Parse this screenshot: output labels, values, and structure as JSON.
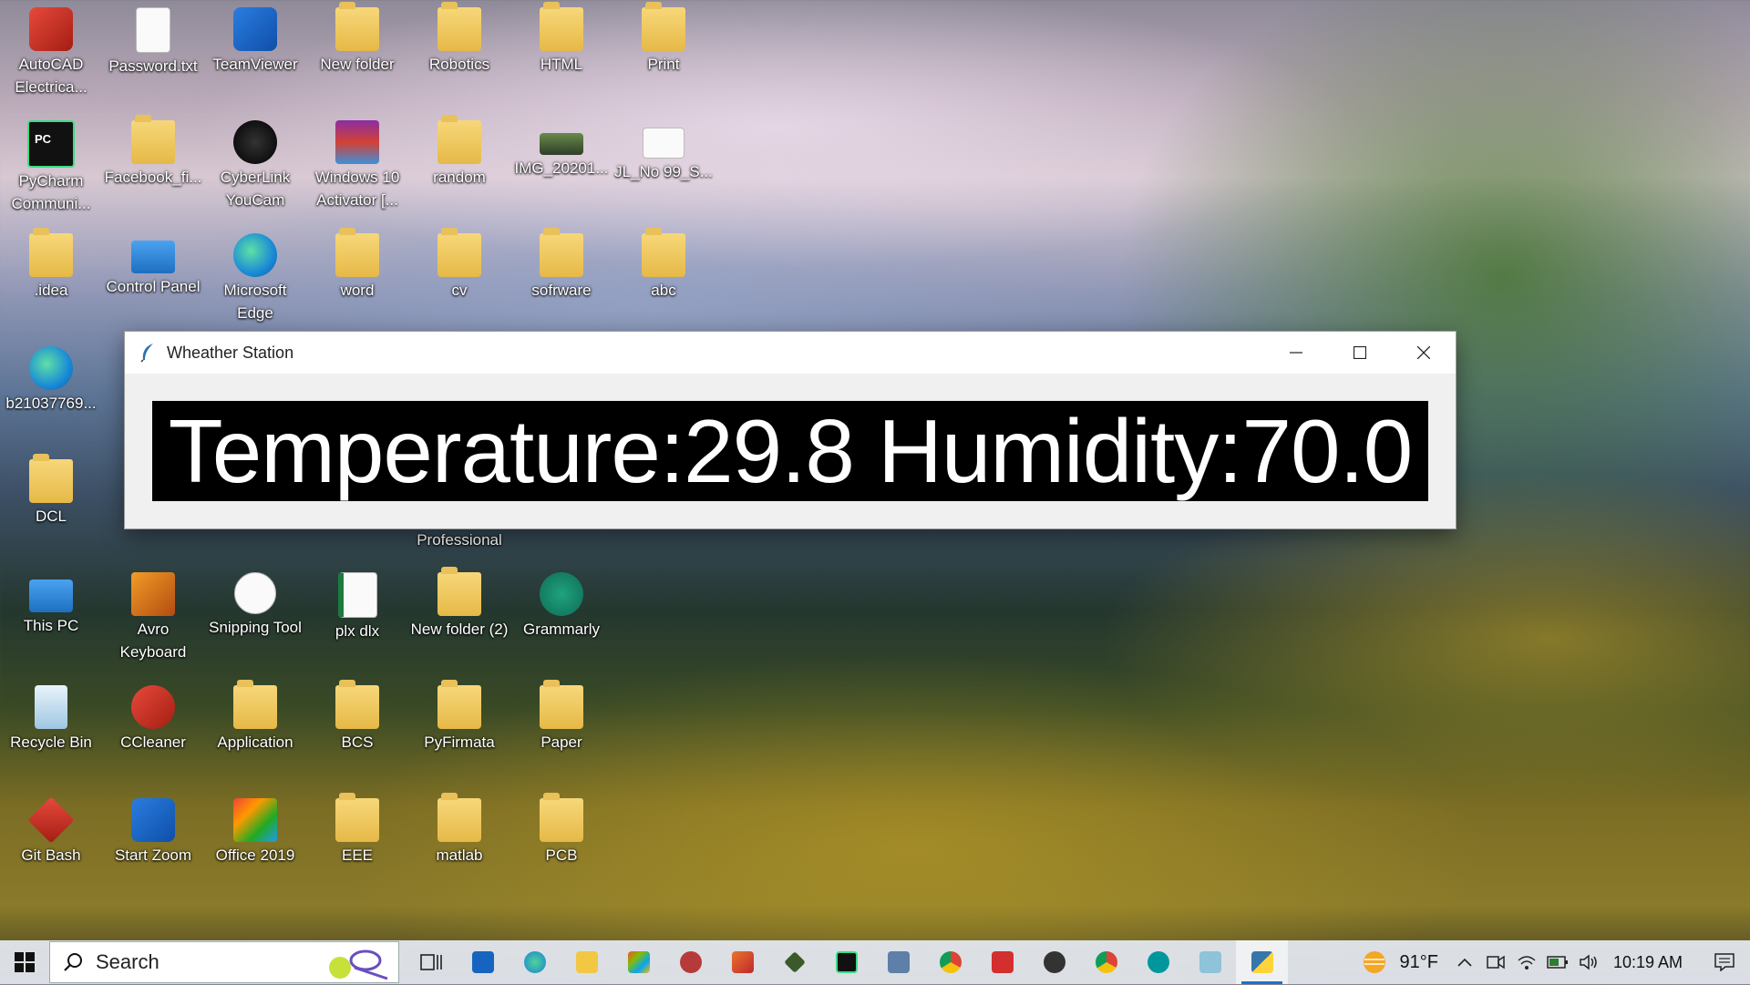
{
  "desktop": {
    "icons": [
      {
        "label": "AutoCAD Electrica...",
        "icon": "autocad-icon"
      },
      {
        "label": "Password.txt",
        "icon": "text-file-icon"
      },
      {
        "label": "TeamViewer",
        "icon": "teamviewer-icon"
      },
      {
        "label": "New folder",
        "icon": "folder-icon"
      },
      {
        "label": "Robotics",
        "icon": "folder-icon"
      },
      {
        "label": "HTML",
        "icon": "folder-icon"
      },
      {
        "label": "Print",
        "icon": "folder-icon"
      },
      {
        "label": "PyCharm Communi...",
        "icon": "pycharm-icon"
      },
      {
        "label": "Facebook_fi...",
        "icon": "folder-icon"
      },
      {
        "label": "CyberLink YouCam",
        "icon": "youcam-icon"
      },
      {
        "label": "Windows 10 Activator [...",
        "icon": "winrar-icon"
      },
      {
        "label": "random",
        "icon": "folder-icon"
      },
      {
        "label": "IMG_20201...",
        "icon": "image-file-icon"
      },
      {
        "label": "JL_No 99_S...",
        "icon": "image-file-icon"
      },
      {
        "label": ".idea",
        "icon": "folder-icon"
      },
      {
        "label": "Control Panel",
        "icon": "control-panel-icon"
      },
      {
        "label": "Microsoft Edge",
        "icon": "edge-icon"
      },
      {
        "label": "word",
        "icon": "folder-icon"
      },
      {
        "label": "cv",
        "icon": "folder-icon"
      },
      {
        "label": "sofrware",
        "icon": "folder-icon"
      },
      {
        "label": "abc",
        "icon": "folder-icon"
      },
      {
        "label": "b21037769...",
        "icon": "edge-icon"
      },
      {
        "label": "DCL",
        "icon": "user-folder-icon"
      },
      {
        "label": "Professional",
        "icon": "folder-icon"
      },
      {
        "label": "This PC",
        "icon": "this-pc-icon"
      },
      {
        "label": "Avro Keyboard",
        "icon": "avro-icon"
      },
      {
        "label": "Snipping Tool",
        "icon": "snipping-tool-icon"
      },
      {
        "label": "plx dlx",
        "icon": "excel-file-icon"
      },
      {
        "label": "New folder (2)",
        "icon": "folder-icon"
      },
      {
        "label": "Grammarly",
        "icon": "grammarly-icon"
      },
      {
        "label": "Recycle Bin",
        "icon": "recycle-bin-icon"
      },
      {
        "label": "CCleaner",
        "icon": "ccleaner-icon"
      },
      {
        "label": "Application",
        "icon": "folder-icon"
      },
      {
        "label": "BCS",
        "icon": "folder-icon"
      },
      {
        "label": "PyFirmata",
        "icon": "folder-icon"
      },
      {
        "label": "Paper",
        "icon": "folder-icon"
      },
      {
        "label": "Git Bash",
        "icon": "git-bash-icon"
      },
      {
        "label": "Start Zoom",
        "icon": "zoom-icon"
      },
      {
        "label": "Office 2019",
        "icon": "office-icon"
      },
      {
        "label": "EEE",
        "icon": "folder-icon"
      },
      {
        "label": "matlab",
        "icon": "folder-icon"
      },
      {
        "label": "PCB",
        "icon": "folder-icon"
      }
    ]
  },
  "window": {
    "title": "Wheather Station",
    "readout": "Temperature:29.8 Humidity:70.0"
  },
  "taskbar": {
    "search_placeholder": "Search",
    "apps": [
      "task-view-icon",
      "mail-icon",
      "edge-icon",
      "file-explorer-icon",
      "store-icon",
      "app-icon",
      "matlab-icon",
      "app-icon",
      "pycharm-icon",
      "app-icon",
      "chrome-icon",
      "app-icon",
      "settings-icon",
      "chrome-icon",
      "arduino-icon",
      "app-icon",
      "python-icon"
    ],
    "weather_temp": "91°F",
    "time": "10:19 AM"
  },
  "colors": {
    "readout_bg": "#000000",
    "readout_fg": "#ffffff",
    "active_indicator": "#1a73c8"
  }
}
